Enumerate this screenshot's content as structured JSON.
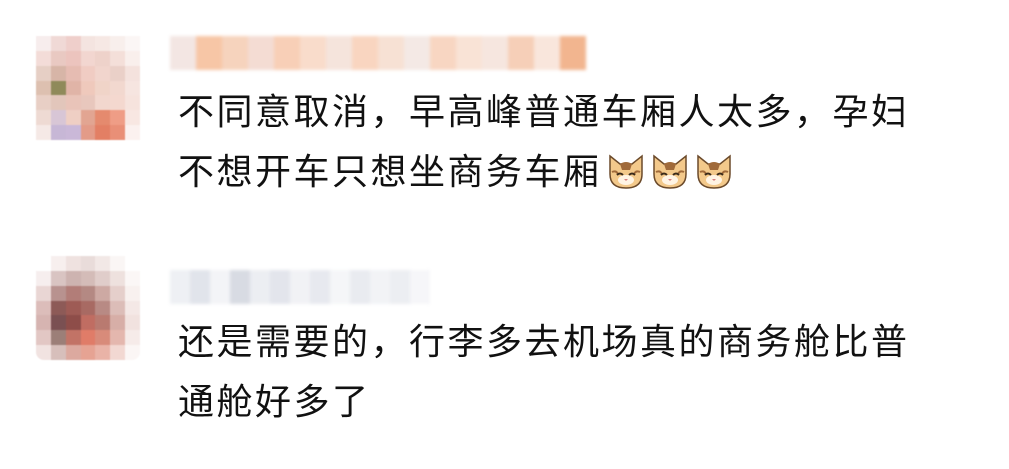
{
  "comments": [
    {
      "username": "",
      "text_line1": "不同意取消，早高峰普通车厢人太多，孕妇",
      "text_line2": "不想开车只想坐商务车厢",
      "emojis": [
        "cat-face-emoji",
        "cat-face-emoji",
        "cat-face-emoji"
      ]
    },
    {
      "username": "",
      "text_line1": "还是需要的，行李多去机场真的商务舱比普",
      "text_line2": "通舱好多了"
    }
  ],
  "colors": {
    "text": "#111111",
    "background": "#ffffff",
    "emoji_cat_fur": "#f3c98b",
    "emoji_cat_stripe": "#a06a3a"
  }
}
